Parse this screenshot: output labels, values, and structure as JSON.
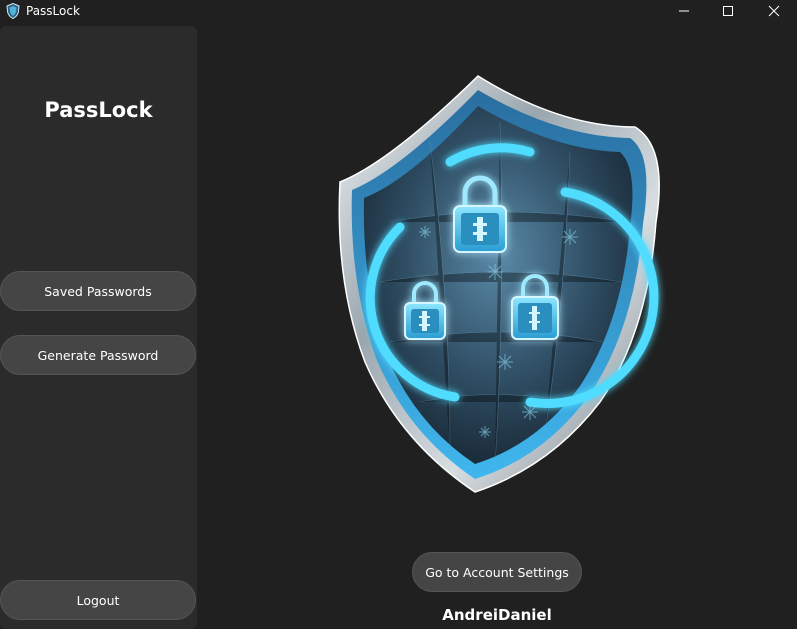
{
  "window": {
    "title": "PassLock",
    "icon": "shield-icon"
  },
  "sidebar": {
    "brand": "PassLock",
    "buttons": {
      "saved": "Saved Passwords",
      "generate": "Generate Password",
      "logout": "Logout"
    }
  },
  "main": {
    "hero_image": "shield-with-padlocks-illustration",
    "account_button": "Go to Account Settings",
    "username": "AndreiDaniel"
  },
  "colors": {
    "background": "#202020",
    "sidebar": "#2b2b2b",
    "button": "#454545",
    "accent": "#3fd0ff"
  }
}
